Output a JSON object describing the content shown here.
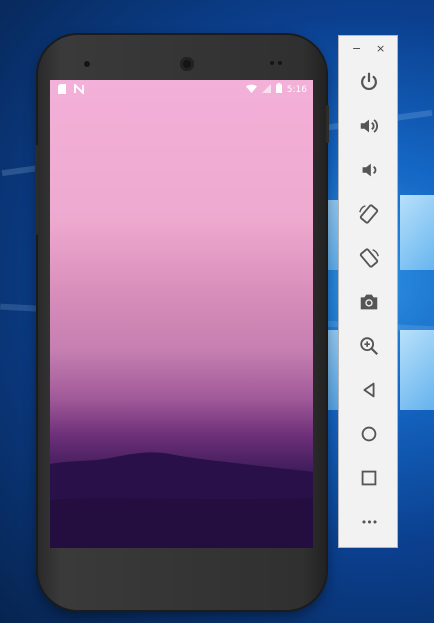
{
  "phone": {
    "status_bar": {
      "time": "5:16"
    }
  },
  "toolbar": {
    "minimize_label": "−",
    "close_label": "×",
    "items": [
      {
        "icon": "power-icon"
      },
      {
        "icon": "volume-up-icon"
      },
      {
        "icon": "volume-down-icon"
      },
      {
        "icon": "rotate-left-icon"
      },
      {
        "icon": "rotate-right-icon"
      },
      {
        "icon": "camera-icon"
      },
      {
        "icon": "zoom-icon"
      },
      {
        "icon": "back-icon"
      },
      {
        "icon": "home-icon"
      },
      {
        "icon": "overview-icon"
      },
      {
        "icon": "more-icon"
      }
    ],
    "more_label": "•••"
  }
}
